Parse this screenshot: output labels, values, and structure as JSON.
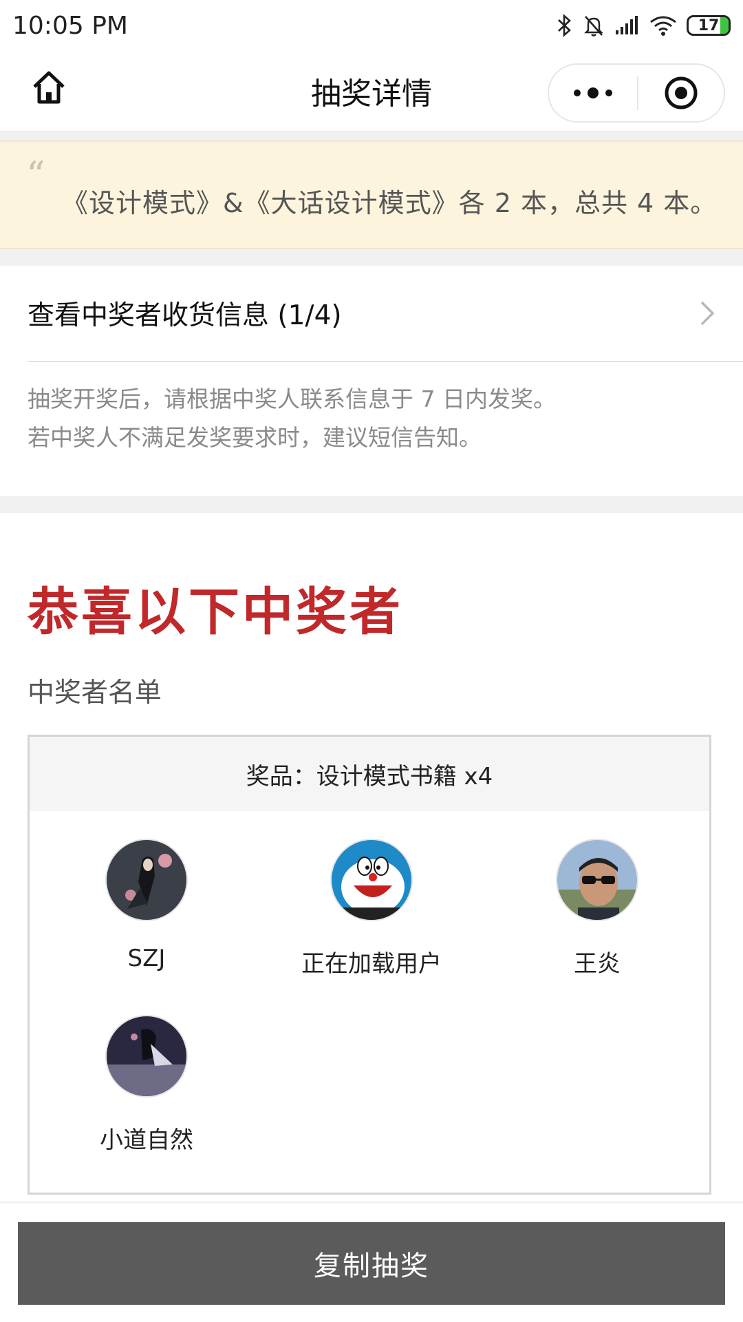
{
  "status_bar": {
    "time": "10:05 PM",
    "battery": "17",
    "icons": [
      "bluetooth-icon",
      "mute-bell-icon",
      "signal-icon",
      "wifi-icon",
      "battery-icon"
    ]
  },
  "nav": {
    "title": "抽奖详情",
    "home_icon": "home-icon",
    "more_icon": "more-dots-icon",
    "close_icon": "target-icon"
  },
  "notice": {
    "quote_mark": "“",
    "text": "《设计模式》&《大话设计模式》各 2 本，总共 4 本。"
  },
  "winner_info": {
    "link_label": "查看中奖者收货信息 (1/4)",
    "hint_lines": [
      "抽奖开奖后，请根据中奖人联系信息于 7 日内发奖。",
      "若中奖人不满足发奖要求时，建议短信告知。"
    ]
  },
  "results": {
    "heading": "恭喜以下中奖者",
    "list_title": "中奖者名单",
    "prize": "奖品：设计模式书籍 x4",
    "winners": [
      {
        "name": "SZJ",
        "avatar": "dark-character"
      },
      {
        "name": "正在加载用户",
        "avatar": "doraemon"
      },
      {
        "name": "王炎",
        "avatar": "sunglasses-man"
      },
      {
        "name": "小道自然",
        "avatar": "dark-figure"
      }
    ]
  },
  "footer": {
    "button_label": "复制抽奖"
  },
  "colors": {
    "accent_red": "#c0282a",
    "notice_bg": "#fdf4de",
    "button_bg": "#5b5b5b",
    "battery_green": "#3ec43e"
  }
}
